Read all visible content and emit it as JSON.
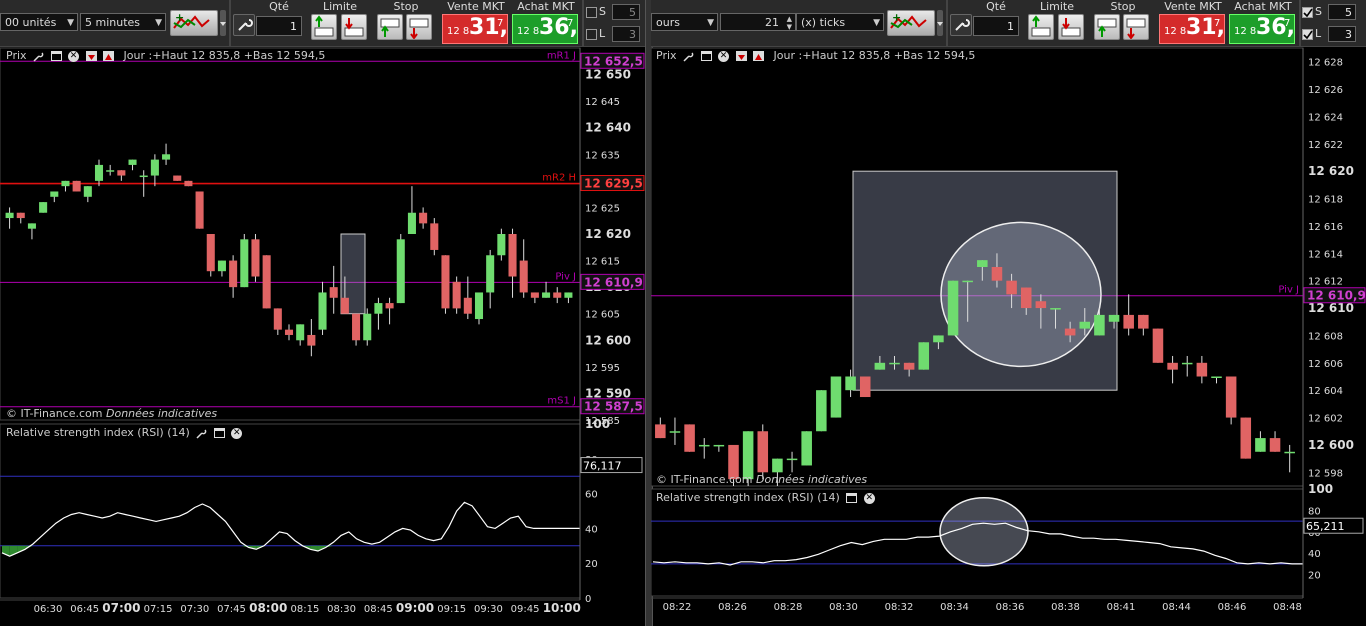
{
  "left": {
    "toolbar": {
      "units": "00 unités",
      "timeframe": "5 minutes",
      "qty_label": "Qté",
      "qty_value": "1",
      "limit_label": "Limite",
      "stop_label": "Stop",
      "sell_label": "Vente MKT",
      "sell_small": "12 8",
      "sell_big": "31,",
      "sell_exp": "7",
      "buy_label": "Achat MKT",
      "buy_small": "12 8",
      "buy_big": "36,",
      "buy_exp": "7",
      "s_label": "S",
      "s_value": "5",
      "l_label": "L",
      "l_value": "3"
    },
    "price_header": "Prix",
    "price_info": "Jour :+Haut 12 835,8 +Bas 12 594,5",
    "watermark_source": "© IT-Finance.com",
    "watermark_note": "Données indicatives",
    "rsi_header": "Relative strength index (RSI) (14)",
    "rsi_value": "76,117",
    "levels": [
      {
        "name": "mR1 J",
        "value": "12 652,5"
      },
      {
        "name": "mR2 H",
        "value": "12 629,5"
      },
      {
        "name": "Piv J",
        "value": "12 610,9"
      },
      {
        "name": "mS1 J",
        "value": "12 587,5"
      }
    ],
    "y_ticks": [
      "12 650",
      "12 645",
      "12 640",
      "12 635",
      "12 630",
      "12 625",
      "12 620",
      "12 615",
      "12 610",
      "12 605",
      "12 600",
      "12 595",
      "12 590",
      "12 585"
    ],
    "rsi_ticks": [
      "100",
      "80",
      "60",
      "40",
      "20",
      "0"
    ],
    "x_ticks": [
      "06:30",
      "06:45",
      "07:00",
      "07:15",
      "07:30",
      "07:45",
      "08:00",
      "08:15",
      "08:30",
      "08:45",
      "09:00",
      "09:15",
      "09:30",
      "09:45",
      "10:00"
    ]
  },
  "right": {
    "toolbar": {
      "units": "ours",
      "ticks_value": "21",
      "ticks_label": "(x) ticks",
      "qty_label": "Qté",
      "qty_value": "1",
      "limit_label": "Limite",
      "stop_label": "Stop",
      "sell_label": "Vente MKT",
      "sell_small": "12 8",
      "sell_big": "31,",
      "sell_exp": "7",
      "buy_label": "Achat MKT",
      "buy_small": "12 8",
      "buy_big": "36,",
      "buy_exp": "7",
      "s_label": "S",
      "s_value": "5",
      "l_label": "L",
      "l_value": "3"
    },
    "price_header": "Prix",
    "price_info": "Jour :+Haut 12 835,8 +Bas 12 594,5",
    "watermark_source": "© IT-Finance.com",
    "watermark_note": "Données indicatives",
    "rsi_header": "Relative strength index (RSI) (14)",
    "rsi_value": "65,211",
    "levels": [
      {
        "name": "Piv J",
        "value": "12 610,9"
      }
    ],
    "y_ticks": [
      "12 628",
      "12 626",
      "12 624",
      "12 622",
      "12 620",
      "12 618",
      "12 616",
      "12 614",
      "12 612",
      "12 610",
      "12 608",
      "12 606",
      "12 604",
      "12 602",
      "12 600",
      "12 598"
    ],
    "rsi_ticks": [
      "100",
      "80",
      "60",
      "40",
      "20"
    ],
    "x_ticks": [
      "08:22",
      "08:26",
      "08:28",
      "08:30",
      "08:32",
      "08:34",
      "08:36",
      "08:38",
      "08:41",
      "08:44",
      "08:46",
      "08:48"
    ]
  },
  "colors": {
    "up": "#6fdc6f",
    "down": "#e06464",
    "pivot": "#b000b0",
    "resistance": "#e01010",
    "rsi_line": "#ffffff",
    "rsi_band": "#3030c0"
  },
  "chart_data": [
    {
      "type": "candlestick",
      "title": "Prix",
      "x_ticks": [
        "06:30",
        "06:45",
        "07:00",
        "07:15",
        "07:30",
        "07:45",
        "08:00",
        "08:15",
        "08:30",
        "08:45",
        "09:00",
        "09:15",
        "09:30",
        "09:45",
        "10:00"
      ],
      "ylim": [
        12585,
        12655
      ],
      "candles": [
        {
          "o": 12623,
          "h": 12625,
          "l": 12621,
          "c": 12624
        },
        {
          "o": 12624,
          "h": 12624,
          "l": 12622,
          "c": 12623
        },
        {
          "o": 12621,
          "h": 12622,
          "l": 12619,
          "c": 12622
        },
        {
          "o": 12624,
          "h": 12626,
          "l": 12624,
          "c": 12626
        },
        {
          "o": 12627,
          "h": 12628,
          "l": 12626,
          "c": 12628
        },
        {
          "o": 12629,
          "h": 12630,
          "l": 12628,
          "c": 12630
        },
        {
          "o": 12630,
          "h": 12630,
          "l": 12628,
          "c": 12628
        },
        {
          "o": 12627,
          "h": 12629,
          "l": 12626,
          "c": 12629
        },
        {
          "o": 12630,
          "h": 12634,
          "l": 12629,
          "c": 12633
        },
        {
          "o": 12632,
          "h": 12633,
          "l": 12631,
          "c": 12632
        },
        {
          "o": 12632,
          "h": 12632,
          "l": 12630,
          "c": 12631
        },
        {
          "o": 12633,
          "h": 12634,
          "l": 12632,
          "c": 12634
        },
        {
          "o": 12631,
          "h": 12632,
          "l": 12627,
          "c": 12631
        },
        {
          "o": 12631,
          "h": 12635,
          "l": 12629,
          "c": 12634
        },
        {
          "o": 12634,
          "h": 12637,
          "l": 12633,
          "c": 12635
        },
        {
          "o": 12631,
          "h": 12631,
          "l": 12630,
          "c": 12630
        },
        {
          "o": 12630,
          "h": 12630,
          "l": 12629,
          "c": 12629
        },
        {
          "o": 12628,
          "h": 12628,
          "l": 12621,
          "c": 12621
        },
        {
          "o": 12620,
          "h": 12620,
          "l": 12612,
          "c": 12613
        },
        {
          "o": 12613,
          "h": 12615,
          "l": 12612,
          "c": 12615
        },
        {
          "o": 12615,
          "h": 12616,
          "l": 12608,
          "c": 12610
        },
        {
          "o": 12610,
          "h": 12620,
          "l": 12610,
          "c": 12619
        },
        {
          "o": 12619,
          "h": 12620,
          "l": 12611,
          "c": 12612
        },
        {
          "o": 12616,
          "h": 12616,
          "l": 12606,
          "c": 12606
        },
        {
          "o": 12606,
          "h": 12606,
          "l": 12601,
          "c": 12602
        },
        {
          "o": 12602,
          "h": 12603,
          "l": 12600,
          "c": 12601
        },
        {
          "o": 12600,
          "h": 12603,
          "l": 12599,
          "c": 12603
        },
        {
          "o": 12601,
          "h": 12604,
          "l": 12597,
          "c": 12599
        },
        {
          "o": 12602,
          "h": 12611,
          "l": 12601,
          "c": 12609
        },
        {
          "o": 12610,
          "h": 12614,
          "l": 12605,
          "c": 12608
        },
        {
          "o": 12608,
          "h": 12612,
          "l": 12605,
          "c": 12605
        },
        {
          "o": 12605,
          "h": 12605,
          "l": 12599,
          "c": 12600
        },
        {
          "o": 12600,
          "h": 12606,
          "l": 12599,
          "c": 12605
        },
        {
          "o": 12605,
          "h": 12608,
          "l": 12602,
          "c": 12607
        },
        {
          "o": 12607,
          "h": 12608,
          "l": 12603,
          "c": 12606
        },
        {
          "o": 12607,
          "h": 12620,
          "l": 12607,
          "c": 12619
        },
        {
          "o": 12620,
          "h": 12629,
          "l": 12620,
          "c": 12624
        },
        {
          "o": 12624,
          "h": 12625,
          "l": 12621,
          "c": 12622
        },
        {
          "o": 12622,
          "h": 12623,
          "l": 12616,
          "c": 12617
        },
        {
          "o": 12616,
          "h": 12616,
          "l": 12605,
          "c": 12606
        },
        {
          "o": 12611,
          "h": 12612,
          "l": 12605,
          "c": 12606
        },
        {
          "o": 12608,
          "h": 12612,
          "l": 12604,
          "c": 12605
        },
        {
          "o": 12604,
          "h": 12609,
          "l": 12603,
          "c": 12609
        },
        {
          "o": 12609,
          "h": 12617,
          "l": 12606,
          "c": 12616
        },
        {
          "o": 12616,
          "h": 12621,
          "l": 12615,
          "c": 12620
        },
        {
          "o": 12620,
          "h": 12621,
          "l": 12608,
          "c": 12612
        },
        {
          "o": 12615,
          "h": 12619,
          "l": 12608,
          "c": 12609
        },
        {
          "o": 12609,
          "h": 12609,
          "l": 12607,
          "c": 12608
        },
        {
          "o": 12608,
          "h": 12611,
          "l": 12608,
          "c": 12609
        },
        {
          "o": 12609,
          "h": 12610,
          "l": 12607,
          "c": 12608
        },
        {
          "o": 12608,
          "h": 12609,
          "l": 12607,
          "c": 12609
        }
      ],
      "highlight_box": {
        "from_candle": 27,
        "to_candle": 28,
        "low": 12605,
        "high": 12620
      },
      "levels": [
        {
          "name": "mR1 J",
          "value": 12652.5
        },
        {
          "name": "mR2 H",
          "value": 12629.5
        },
        {
          "name": "Piv J",
          "value": 12610.9
        },
        {
          "name": "mS1 J",
          "value": 12587.5
        }
      ]
    },
    {
      "type": "line",
      "title": "Relative strength index (RSI) (14)",
      "ylim": [
        0,
        100
      ],
      "bands": [
        30,
        70
      ],
      "last_value": 76.117,
      "values": [
        26,
        24,
        26,
        28,
        31,
        35,
        39,
        43,
        46,
        48,
        49,
        48,
        47,
        46,
        47,
        49,
        48,
        47,
        46,
        45,
        44,
        45,
        46,
        47,
        49,
        52,
        54,
        52,
        48,
        44,
        38,
        32,
        29,
        28,
        30,
        34,
        38,
        37,
        33,
        30,
        28,
        27,
        29,
        32,
        36,
        38,
        34,
        32,
        31,
        32,
        35,
        38,
        40,
        39,
        36,
        34,
        33,
        34,
        41,
        50,
        55,
        53,
        47,
        41,
        40,
        43,
        46,
        47,
        41,
        40,
        40,
        40,
        40,
        40,
        40,
        40
      ]
    },
    {
      "type": "candlestick",
      "title": "Prix",
      "x_ticks": [
        "08:22",
        "08:26",
        "08:28",
        "08:30",
        "08:32",
        "08:34",
        "08:36",
        "08:38",
        "08:41",
        "08:44",
        "08:46",
        "08:48"
      ],
      "ylim": [
        12597,
        12629
      ],
      "candles": [
        {
          "o": 12601.5,
          "h": 12602,
          "l": 12600.5,
          "c": 12600.5
        },
        {
          "o": 12601,
          "h": 12602,
          "l": 12600,
          "c": 12601
        },
        {
          "o": 12601.5,
          "h": 12601.5,
          "l": 12599.5,
          "c": 12599.5
        },
        {
          "o": 12600,
          "h": 12600.5,
          "l": 12599,
          "c": 12600
        },
        {
          "o": 12600,
          "h": 12600,
          "l": 12599.5,
          "c": 12600
        },
        {
          "o": 12600,
          "h": 12600,
          "l": 12597,
          "c": 12597.5
        },
        {
          "o": 12597.5,
          "h": 12601,
          "l": 12597,
          "c": 12601
        },
        {
          "o": 12601,
          "h": 12601.5,
          "l": 12597.5,
          "c": 12598
        },
        {
          "o": 12598,
          "h": 12599,
          "l": 12597,
          "c": 12599
        },
        {
          "o": 12599,
          "h": 12599.5,
          "l": 12598,
          "c": 12599
        },
        {
          "o": 12598.5,
          "h": 12601,
          "l": 12598.5,
          "c": 12601
        },
        {
          "o": 12601,
          "h": 12604,
          "l": 12601,
          "c": 12604
        },
        {
          "o": 12602,
          "h": 12605,
          "l": 12602,
          "c": 12605
        },
        {
          "o": 12604,
          "h": 12605.5,
          "l": 12603.5,
          "c": 12605
        },
        {
          "o": 12605,
          "h": 12605,
          "l": 12603.5,
          "c": 12603.5
        },
        {
          "o": 12605.5,
          "h": 12606.5,
          "l": 12605.5,
          "c": 12606
        },
        {
          "o": 12606,
          "h": 12606.5,
          "l": 12605.5,
          "c": 12606
        },
        {
          "o": 12606,
          "h": 12606,
          "l": 12605,
          "c": 12605.5
        },
        {
          "o": 12605.5,
          "h": 12607.5,
          "l": 12605.5,
          "c": 12607.5
        },
        {
          "o": 12607.5,
          "h": 12608,
          "l": 12607,
          "c": 12608
        },
        {
          "o": 12608,
          "h": 12612,
          "l": 12608,
          "c": 12612
        },
        {
          "o": 12612,
          "h": 12612,
          "l": 12609,
          "c": 12612
        },
        {
          "o": 12613,
          "h": 12613.5,
          "l": 12612,
          "c": 12613.5
        },
        {
          "o": 12613,
          "h": 12614,
          "l": 12611.5,
          "c": 12612
        },
        {
          "o": 12612,
          "h": 12612.5,
          "l": 12610,
          "c": 12611
        },
        {
          "o": 12611.5,
          "h": 12611.5,
          "l": 12609.5,
          "c": 12610
        },
        {
          "o": 12610.5,
          "h": 12611,
          "l": 12608.5,
          "c": 12610
        },
        {
          "o": 12610,
          "h": 12610,
          "l": 12608.5,
          "c": 12610
        },
        {
          "o": 12608.5,
          "h": 12609,
          "l": 12607.5,
          "c": 12608
        },
        {
          "o": 12608.5,
          "h": 12610,
          "l": 12608,
          "c": 12609
        },
        {
          "o": 12608,
          "h": 12610,
          "l": 12608,
          "c": 12609.5
        },
        {
          "o": 12609,
          "h": 12609.5,
          "l": 12608.5,
          "c": 12609.5
        },
        {
          "o": 12609.5,
          "h": 12611,
          "l": 12608,
          "c": 12608.5
        },
        {
          "o": 12609.5,
          "h": 12609.5,
          "l": 12608,
          "c": 12608.5
        },
        {
          "o": 12608.5,
          "h": 12608.5,
          "l": 12606,
          "c": 12606
        },
        {
          "o": 12606,
          "h": 12606.5,
          "l": 12604.5,
          "c": 12605.5
        },
        {
          "o": 12606,
          "h": 12606.5,
          "l": 12605,
          "c": 12606
        },
        {
          "o": 12606,
          "h": 12606.5,
          "l": 12604.5,
          "c": 12605
        },
        {
          "o": 12605,
          "h": 12605,
          "l": 12604.5,
          "c": 12605
        },
        {
          "o": 12605,
          "h": 12605,
          "l": 12601.5,
          "c": 12602
        },
        {
          "o": 12602,
          "h": 12602,
          "l": 12599,
          "c": 12599
        },
        {
          "o": 12599.5,
          "h": 12601,
          "l": 12599.5,
          "c": 12600.5
        },
        {
          "o": 12600.5,
          "h": 12601,
          "l": 12599.5,
          "c": 12599.5
        },
        {
          "o": 12599.5,
          "h": 12600,
          "l": 12598,
          "c": 12599.5
        }
      ],
      "highlight_box": {
        "from": "08:29",
        "to": "08:38",
        "low": 12604,
        "high": 12620
      },
      "levels": [
        {
          "name": "Piv J",
          "value": 12610.9
        }
      ]
    },
    {
      "type": "line",
      "title": "Relative strength index (RSI) (14)",
      "ylim": [
        0,
        100
      ],
      "bands": [
        30,
        70
      ],
      "last_value": 65.211,
      "values": [
        32,
        31,
        32,
        31,
        31,
        30,
        31,
        29,
        32,
        32,
        31,
        33,
        33,
        34,
        36,
        39,
        43,
        47,
        50,
        48,
        51,
        53,
        53,
        53,
        55,
        55,
        56,
        60,
        63,
        67,
        68,
        67,
        68,
        64,
        61,
        60,
        58,
        58,
        56,
        54,
        54,
        53,
        53,
        52,
        51,
        50,
        49,
        46,
        45,
        44,
        42,
        38,
        35,
        31,
        30,
        31,
        30,
        31,
        30,
        30
      ]
    }
  ]
}
